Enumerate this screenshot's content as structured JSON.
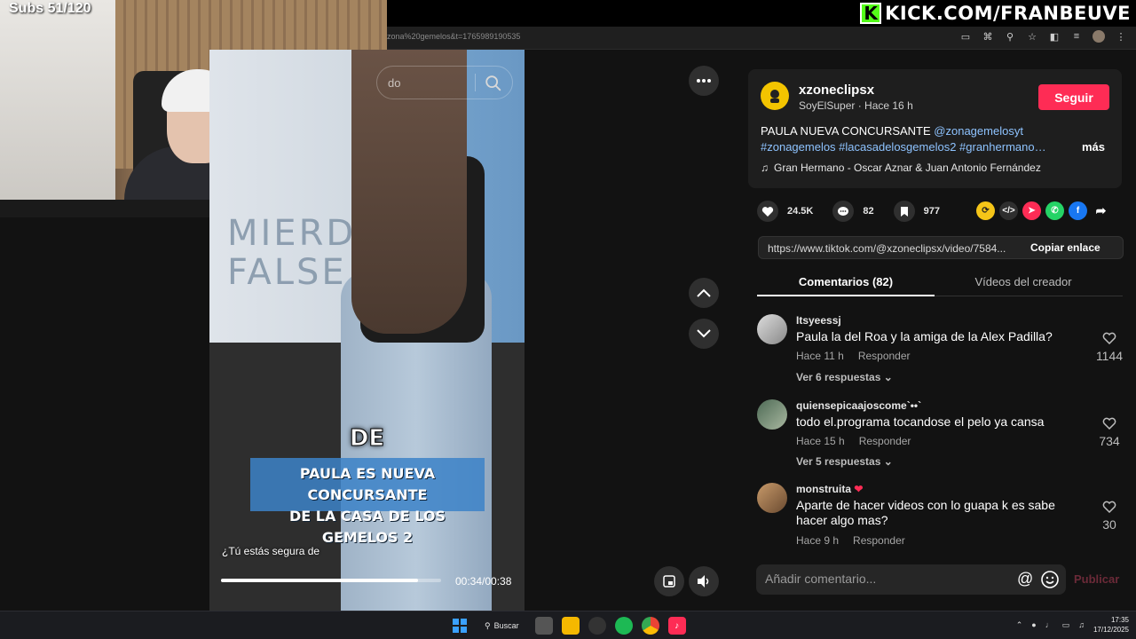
{
  "stream": {
    "subs_counter": "Subs 51/120",
    "kick_logo_letter": "K",
    "kick_url": "KICK.COM/FRANBEUVE"
  },
  "browser": {
    "url_fragment": "zona%20gemelos&t=1765989190535",
    "icons": [
      "cast-icon",
      "translate-icon",
      "zoom-icon",
      "star-icon",
      "extensions-icon",
      "queue-icon",
      "profile-avatar",
      "menu-icon"
    ]
  },
  "search": {
    "placeholder_fragment": "do"
  },
  "video": {
    "wall_writing": [
      "MIERDA",
      "FALSE"
    ],
    "overlay_word": "DE",
    "caption_lines": [
      "PAULA ES NUEVA CONCURSANTE",
      "DE LA CASA DE LOS GEMELOS 2"
    ],
    "subtitle": "¿Tú estás segura de",
    "time": "00:34/00:38",
    "progress": 0.895
  },
  "post": {
    "author": "xzoneclipsx",
    "subline": "SoyElSuper · Hace 16 h",
    "follow_label": "Seguir",
    "desc_plain": "PAULA NUEVA CONCURSANTE ",
    "desc_mention": "@zonagemelosyt",
    "desc_tags": "#zonagemelos #lacasadelosgemelos2 #granhermano…",
    "more_label": "más",
    "music": "Gran Hermano - Oscar Aznar & Juan Antonio Fernández"
  },
  "actions": {
    "likes": "24.5K",
    "comments": "82",
    "saves": "977"
  },
  "share": {
    "link": "https://www.tiktok.com/@xzoneclipsx/video/7584...",
    "copy_label": "Copiar enlace"
  },
  "tabs": {
    "comments": "Comentarios (82)",
    "videos": "Vídeos del creador"
  },
  "comments": [
    {
      "user": "Itsyeessj",
      "text": "Paula la del Roa y la amiga de la Alex Padilla?",
      "time": "Hace 11 h",
      "reply": "Responder",
      "likes": "1144",
      "replies": "Ver 6 respuestas"
    },
    {
      "user": "quiensepicaajoscome`••`",
      "text": "todo el.programa tocandose el pelo ya cansa",
      "time": "Hace 15 h",
      "reply": "Responder",
      "likes": "734",
      "replies": "Ver 5 respuestas"
    },
    {
      "user": "monstruita",
      "text": "Aparte de hacer videos con lo guapa k es sabe hacer algo mas?",
      "time": "Hace 9 h",
      "reply": "Responder",
      "likes": "30"
    }
  ],
  "composer": {
    "placeholder": "Añadir comentario...",
    "publish": "Publicar"
  },
  "taskbar": {
    "search_label": "Buscar",
    "time": "17:35",
    "date": "17/12/2025"
  },
  "colors": {
    "accent": "#fe2c55",
    "kick_green": "#53fc18",
    "link_blue": "#8ec3ff"
  }
}
